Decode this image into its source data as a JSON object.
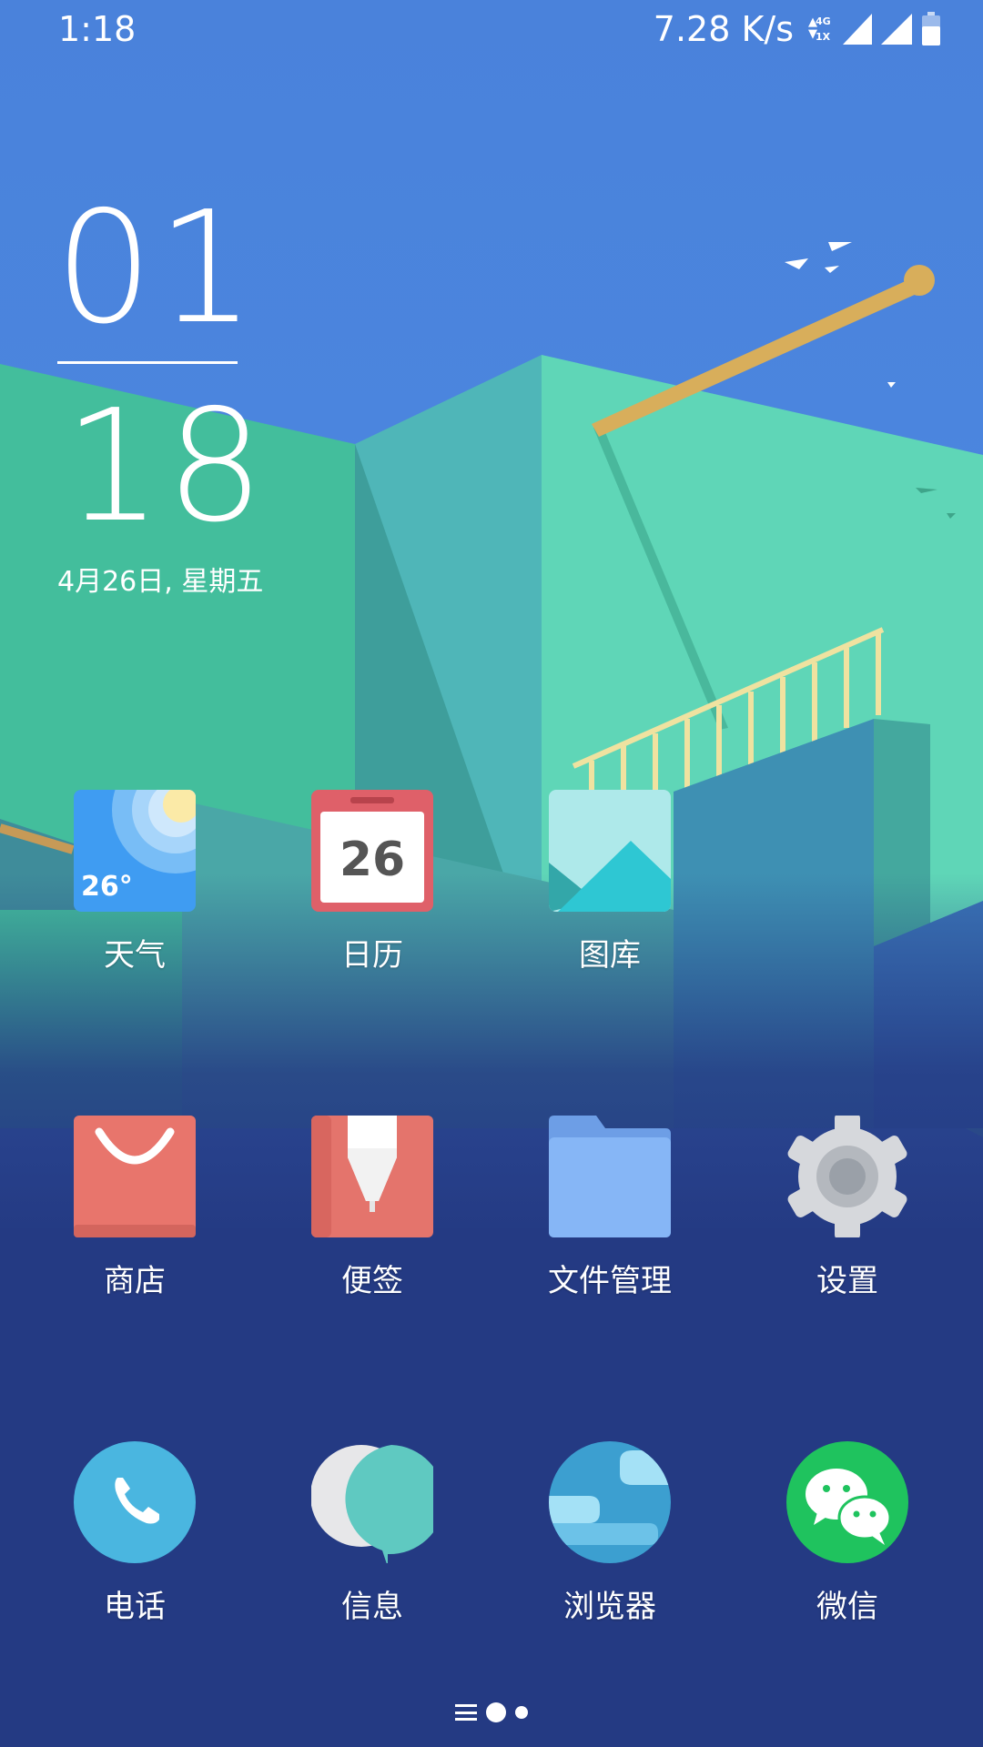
{
  "status_bar": {
    "time": "1:18",
    "net_speed": "7.28 K/s",
    "net_type_top": "4G",
    "net_type_bottom": "1X"
  },
  "clock": {
    "hour": "01",
    "minute": "18",
    "date": "4月26日, 星期五"
  },
  "apps": {
    "weather": {
      "label": "天气",
      "temp": "26°"
    },
    "calendar": {
      "label": "日历",
      "day": "26"
    },
    "gallery": {
      "label": "图库"
    },
    "store": {
      "label": "商店"
    },
    "notes": {
      "label": "便签"
    },
    "files": {
      "label": "文件管理"
    },
    "settings": {
      "label": "设置"
    }
  },
  "dock": {
    "phone": {
      "label": "电话"
    },
    "messages": {
      "label": "信息"
    },
    "browser": {
      "label": "浏览器"
    },
    "wechat": {
      "label": "微信"
    }
  },
  "page_indicator": {
    "total_pages": 2,
    "current_page": 1
  },
  "colors": {
    "sky": "#4a86de",
    "bottom": "#243a83",
    "wechat": "#1fc35e",
    "store": "#e8756c",
    "calendar": "#df6069"
  }
}
